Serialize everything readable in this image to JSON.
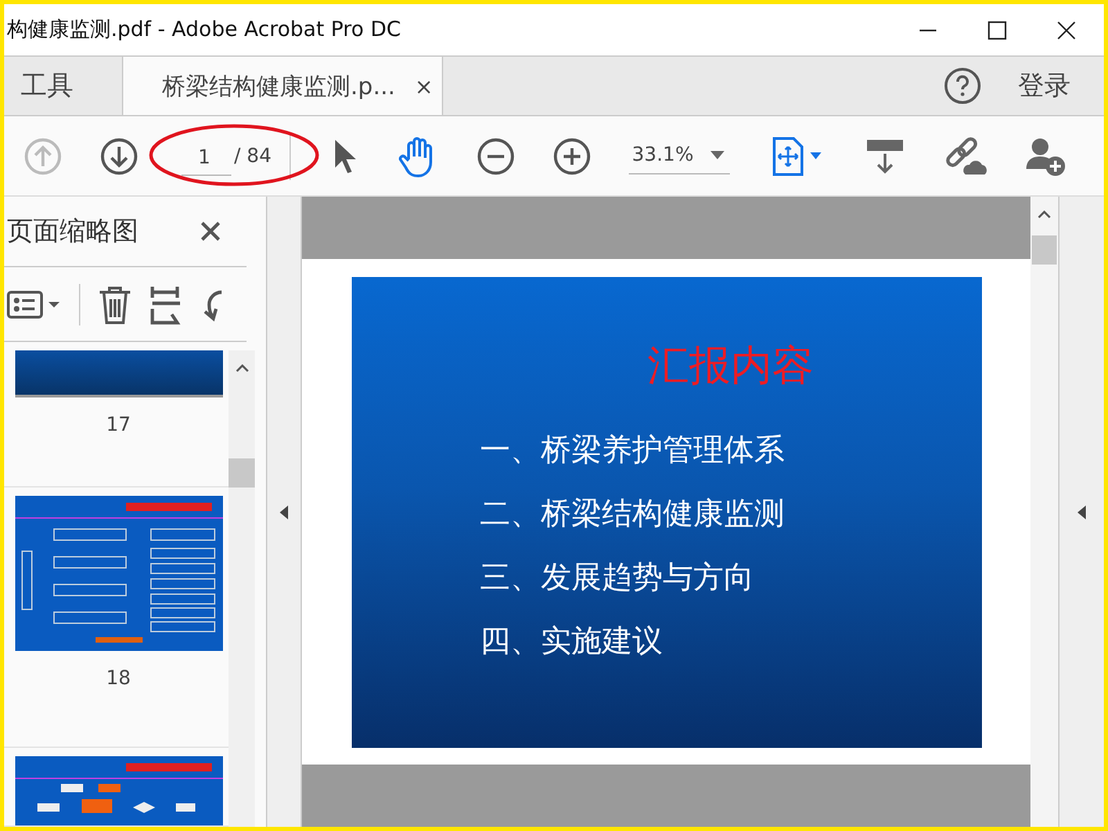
{
  "window": {
    "title": "构健康监测.pdf - Adobe Acrobat Pro DC"
  },
  "tabs": [
    {
      "label": "工具",
      "selected": false
    },
    {
      "label": "桥梁结构健康监测.p...",
      "selected": true,
      "close": "×"
    }
  ],
  "account": {
    "sign_in": "登录"
  },
  "toolbar": {
    "prev_disabled": true,
    "page_value": "1",
    "page_total": "/ 84",
    "hand_selected": true,
    "zoom": "33.1%"
  },
  "thumbnail_pane": {
    "title": "页面缩略图",
    "thumbnails": [
      {
        "kind": "partial",
        "label": "17"
      },
      {
        "kind": "diagram",
        "label": "18"
      },
      {
        "kind": "flow"
      }
    ]
  },
  "slide": {
    "title": "汇报内容",
    "items": [
      "一、桥梁养护管理体系",
      "二、桥梁结构健康监测",
      "三、发展趋势与方向",
      "四、实施建议"
    ]
  }
}
